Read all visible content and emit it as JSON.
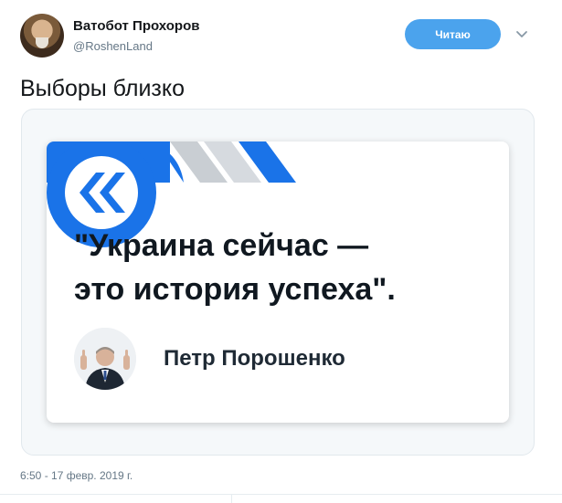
{
  "author": {
    "name": "Ватобот Прохоров",
    "handle": "@RoshenLand"
  },
  "follow_button": {
    "label": "Читаю"
  },
  "menu_icon": "chevron-down-icon",
  "tweet": {
    "text": "Выборы близко"
  },
  "card": {
    "quote_line1": "\"Украина сейчас —",
    "quote_line2": "это история успеха\".",
    "person": "Петр Порошенко",
    "logo_icon": "double-chevron-left-icon",
    "accent_color": "#1a73e8"
  },
  "timestamp": "6:50 - 17 февр. 2019 г."
}
